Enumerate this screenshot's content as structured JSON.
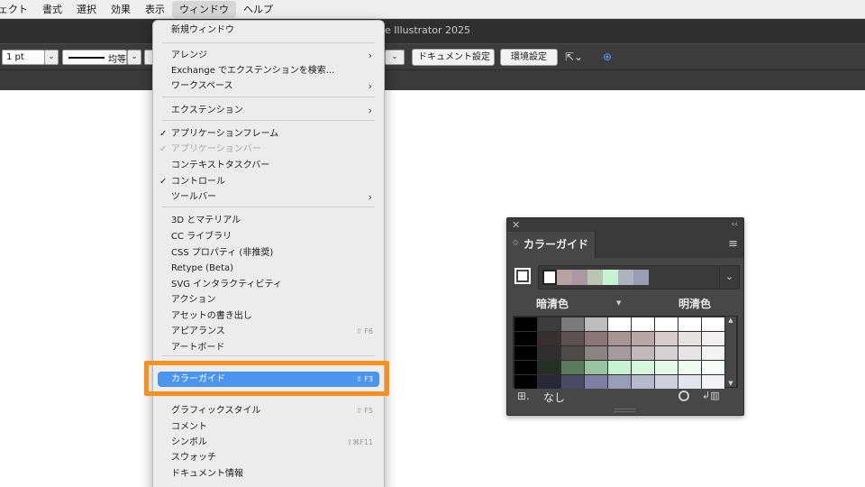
{
  "menubar": {
    "items": [
      "ェクト",
      "書式",
      "選択",
      "効果",
      "表示",
      "ウィンドウ",
      "ヘルプ"
    ],
    "active_index": 5
  },
  "app_title": "e Illustrator 2025",
  "controlbar": {
    "stroke_weight": "1 pt",
    "stroke_profile": "均等",
    "document_setup": "ドキュメント設定",
    "preferences": "環境設定"
  },
  "window_menu": {
    "items": [
      {
        "label": "新規ウィンドウ"
      },
      {
        "label": "アレンジ",
        "submenu": true
      },
      {
        "label": "Exchange でエクステンションを検索..."
      },
      {
        "label": "ワークスペース",
        "submenu": true
      },
      {
        "label": "エクステンション",
        "submenu": true
      },
      {
        "label": "アプリケーションフレーム",
        "checked": true
      },
      {
        "label": "アプリケーションバー",
        "checked": true,
        "disabled": true
      },
      {
        "label": "コンテキストタスクバー"
      },
      {
        "label": "コントロール",
        "checked": true
      },
      {
        "label": "ツールバー",
        "submenu": true
      },
      {
        "label": "3D とマテリアル"
      },
      {
        "label": "CC ライブラリ"
      },
      {
        "label": "CSS プロパティ (非推奨)"
      },
      {
        "label": "Retype (Beta)"
      },
      {
        "label": "SVG インタラクティビティ"
      },
      {
        "label": "アクション"
      },
      {
        "label": "アセットの書き出し"
      },
      {
        "label": "アピアランス",
        "shortcut": "⇧ F6"
      },
      {
        "label": "アートボード"
      },
      {
        "label": "カラーガイド",
        "shortcut": "⇧ F3",
        "highlighted": true
      },
      {
        "label": "グラフィックスタイル",
        "shortcut": "⇧ F5"
      },
      {
        "label": "コメント"
      },
      {
        "label": "シンボル",
        "shortcut": "⇧⌘F11"
      },
      {
        "label": "スウォッチ"
      },
      {
        "label": "ドキュメント情報"
      }
    ],
    "highlight_color": "#4b95ef",
    "callout_color": "#f7911e"
  },
  "color_guide_panel": {
    "title": "カラーガイド",
    "shades_label": "暗清色",
    "tints_label": "明清色",
    "none_label": "なし",
    "harmony_colors": [
      "#ffffff",
      "#b7a3a3",
      "#a89aa0",
      "#b8c5b0",
      "#c6f3d2",
      "#aeb3bd",
      "#9a9db8"
    ],
    "grid": [
      [
        "#000000",
        "#3c3c3c",
        "#7a7a7a",
        "#bdbdbd",
        "#ffffff",
        "#ffffff",
        "#ffffff",
        "#ffffff",
        "#ffffff"
      ],
      [
        "#000000",
        "#383030",
        "#5e5050",
        "#8a7676",
        "#a79595",
        "#b8a7a7",
        "#d7cccc",
        "#e7e3e3",
        "#f2f0f0"
      ],
      [
        "#000000",
        "#302e2e",
        "#4e4a4a",
        "#8a8484",
        "#a59b9f",
        "#c1b9bc",
        "#d6d1d3",
        "#e6e4e5",
        "#f4f3f3"
      ],
      [
        "#000000",
        "#233023",
        "#5a7a5e",
        "#97c3a0",
        "#c6f3d2",
        "#d6f7de",
        "#e3f9e8",
        "#eefcf1",
        "#f6fdf8"
      ],
      [
        "#000000",
        "#282838",
        "#4a4a66",
        "#7f7fa4",
        "#9a9db8",
        "#b6b8cc",
        "#cfd0de",
        "#e3e4ec",
        "#f2f2f6"
      ]
    ]
  }
}
